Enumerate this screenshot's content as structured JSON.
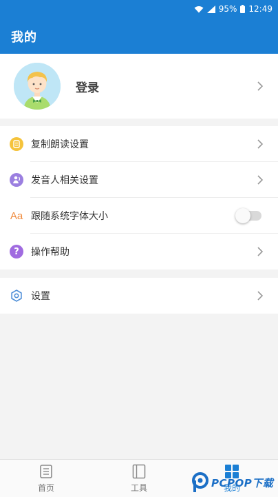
{
  "status_bar": {
    "battery": "95%",
    "time": "12:49",
    "icons": [
      "wifi-icon",
      "signal-icon",
      "battery-icon"
    ]
  },
  "header": {
    "title": "我的"
  },
  "profile": {
    "login_label": "登录",
    "avatar_icon": "boy-avatar-icon"
  },
  "menu": {
    "items": [
      {
        "label": "复制朗读设置",
        "icon": "copy-read-icon"
      },
      {
        "label": "发音人相关设置",
        "icon": "speaker-person-icon"
      },
      {
        "label": "跟随系统字体大小",
        "icon": "font-size-icon",
        "icon_text": "Aa",
        "toggle_on": false
      },
      {
        "label": "操作帮助",
        "icon": "help-icon",
        "icon_text": "?"
      }
    ],
    "settings": {
      "label": "设置",
      "icon": "gear-icon"
    }
  },
  "bottom_nav": {
    "items": [
      {
        "label": "首页",
        "icon": "home-doc-icon"
      },
      {
        "label": "工具",
        "icon": "tools-icon"
      },
      {
        "label": "我的",
        "icon": "mine-grid-icon",
        "active": true
      }
    ]
  },
  "watermark": {
    "text": "PCPOP下载"
  },
  "colors": {
    "primary": "#1b7fd4",
    "copy_icon": "#f5c33b",
    "speaker_icon": "#9b7fe0",
    "font_icon": "#f08a3c",
    "help_icon": "#a06be0",
    "gear_icon": "#4f8fd8"
  }
}
